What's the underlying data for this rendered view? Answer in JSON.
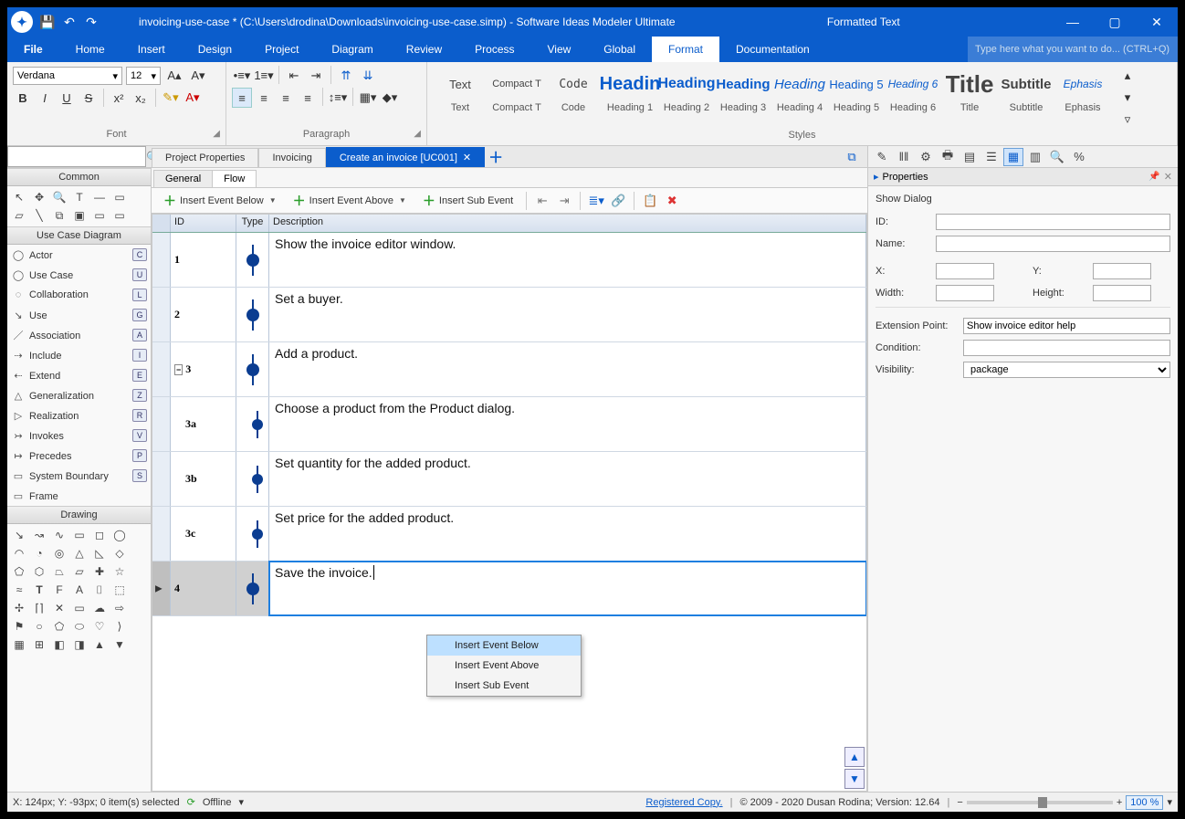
{
  "title": "invoicing-use-case * (C:\\Users\\drodina\\Downloads\\invoicing-use-case.simp)  -  Software Ideas Modeler Ultimate",
  "context_tab": "Formatted Text",
  "menu": [
    "File",
    "Home",
    "Insert",
    "Design",
    "Project",
    "Diagram",
    "Review",
    "Process",
    "View",
    "Global",
    "Format",
    "Documentation"
  ],
  "menu_active": "Format",
  "search_placeholder": "Type here what you want to do...   (CTRL+Q)",
  "ribbon": {
    "font": {
      "name": "Verdana",
      "size": "12",
      "group": "Font"
    },
    "paragraph_group": "Paragraph",
    "styles_group": "Styles",
    "styles": [
      {
        "preview": "Text",
        "name": "Text"
      },
      {
        "preview": "Compact T",
        "name": "Compact T"
      },
      {
        "preview": "Code",
        "name": "Code"
      },
      {
        "preview": "Headin",
        "name": "Heading 1"
      },
      {
        "preview": "Heading",
        "name": "Heading 2"
      },
      {
        "preview": "Heading",
        "name": "Heading 3"
      },
      {
        "preview": "Heading",
        "name": "Heading 4"
      },
      {
        "preview": "Heading 5",
        "name": "Heading 5"
      },
      {
        "preview": "Heading 6",
        "name": "Heading 6"
      },
      {
        "preview": "Title",
        "name": "Title"
      },
      {
        "preview": "Subtitle",
        "name": "Subtitle"
      },
      {
        "preview": "Ephasis",
        "name": "Ephasis"
      }
    ]
  },
  "left": {
    "common": "Common",
    "usecase_group": "Use Case Diagram",
    "drawing_group": "Drawing",
    "tools": [
      {
        "icon": "◯",
        "label": "Actor",
        "key": "C"
      },
      {
        "icon": "◯",
        "label": "Use Case",
        "key": "U"
      },
      {
        "icon": "◌",
        "label": "Collaboration",
        "key": "L"
      },
      {
        "icon": "↘",
        "label": "Use",
        "key": "G"
      },
      {
        "icon": "／",
        "label": "Association",
        "key": "A"
      },
      {
        "icon": "⇢",
        "label": "Include",
        "key": "I"
      },
      {
        "icon": "⇠",
        "label": "Extend",
        "key": "E"
      },
      {
        "icon": "△",
        "label": "Generalization",
        "key": "Z"
      },
      {
        "icon": "▷",
        "label": "Realization",
        "key": "R"
      },
      {
        "icon": "↣",
        "label": "Invokes",
        "key": "V"
      },
      {
        "icon": "↦",
        "label": "Precedes",
        "key": "P"
      },
      {
        "icon": "▭",
        "label": "System Boundary",
        "key": "S"
      },
      {
        "icon": "▭",
        "label": "Frame",
        "key": ""
      }
    ]
  },
  "tabs": [
    {
      "label": "Project Properties",
      "active": false
    },
    {
      "label": "Invoicing",
      "active": false
    },
    {
      "label": "Create an invoice [UC001]",
      "active": true
    }
  ],
  "subtabs": {
    "general": "General",
    "flow": "Flow"
  },
  "flow_toolbar": {
    "insert_below": "Insert Event Below",
    "insert_above": "Insert Event Above",
    "insert_sub": "Insert Sub Event"
  },
  "columns": {
    "id": "ID",
    "type": "Type",
    "desc": "Description"
  },
  "rows": [
    {
      "id": "1",
      "desc": "Show the invoice editor window.",
      "sub": false
    },
    {
      "id": "2",
      "desc": "Set a buyer.",
      "sub": false
    },
    {
      "id": "3",
      "desc": "Add a product.",
      "sub": false,
      "expand": true
    },
    {
      "id": "3a",
      "desc": "Choose a product from the Product dialog.",
      "sub": true
    },
    {
      "id": "3b",
      "desc": "Set quantity for the added product.",
      "sub": true
    },
    {
      "id": "3c",
      "desc": "Set price for the added product.",
      "sub": true
    },
    {
      "id": "4",
      "desc": "Save the invoice.",
      "sub": false,
      "selected": true
    }
  ],
  "context_menu": [
    "Insert Event Below",
    "Insert Event Above",
    "Insert Sub Event"
  ],
  "properties": {
    "title": "Properties",
    "line": "Show Dialog",
    "id_label": "ID:",
    "name_label": "Name:",
    "x_label": "X:",
    "y_label": "Y:",
    "width_label": "Width:",
    "height_label": "Height:",
    "ext_label": "Extension Point:",
    "ext_value": "Show invoice editor help",
    "cond_label": "Condition:",
    "vis_label": "Visibility:",
    "vis_value": "package"
  },
  "status": {
    "left": "X: 124px; Y: -93px; 0 item(s) selected",
    "offline": "Offline",
    "reg": "Registered Copy.",
    "copy": "© 2009 - 2020 Dusan Rodina; Version: 12.64",
    "zoom": "100 %"
  }
}
